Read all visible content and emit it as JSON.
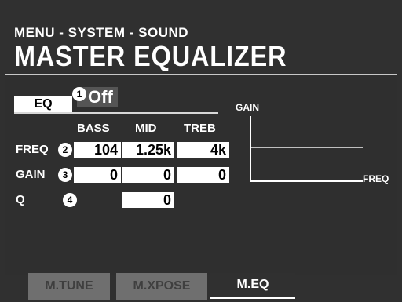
{
  "header": {
    "breadcrumb": "MENU - SYSTEM - SOUND",
    "title": "MASTER EQUALIZER"
  },
  "eq": {
    "label": "EQ",
    "value": "Off"
  },
  "markers": [
    "1",
    "2",
    "3",
    "4"
  ],
  "columns": [
    "BASS",
    "MID",
    "TREB"
  ],
  "rows": [
    {
      "label": "FREQ",
      "values": [
        "104",
        "1.25k",
        "4k"
      ]
    },
    {
      "label": "GAIN",
      "values": [
        "0",
        "0",
        "0"
      ]
    },
    {
      "label": "Q",
      "values": [
        "",
        "0",
        ""
      ]
    }
  ],
  "graph": {
    "y_label": "GAIN",
    "x_label": "FREQ"
  },
  "tabs": [
    {
      "label": "M.TUNE",
      "active": false
    },
    {
      "label": "M.XPOSE",
      "active": false
    },
    {
      "label": "M.EQ",
      "active": true
    }
  ],
  "colors": {
    "background": "#303030",
    "text": "#ffffff",
    "inactive_tab": "#6f6f6f"
  }
}
